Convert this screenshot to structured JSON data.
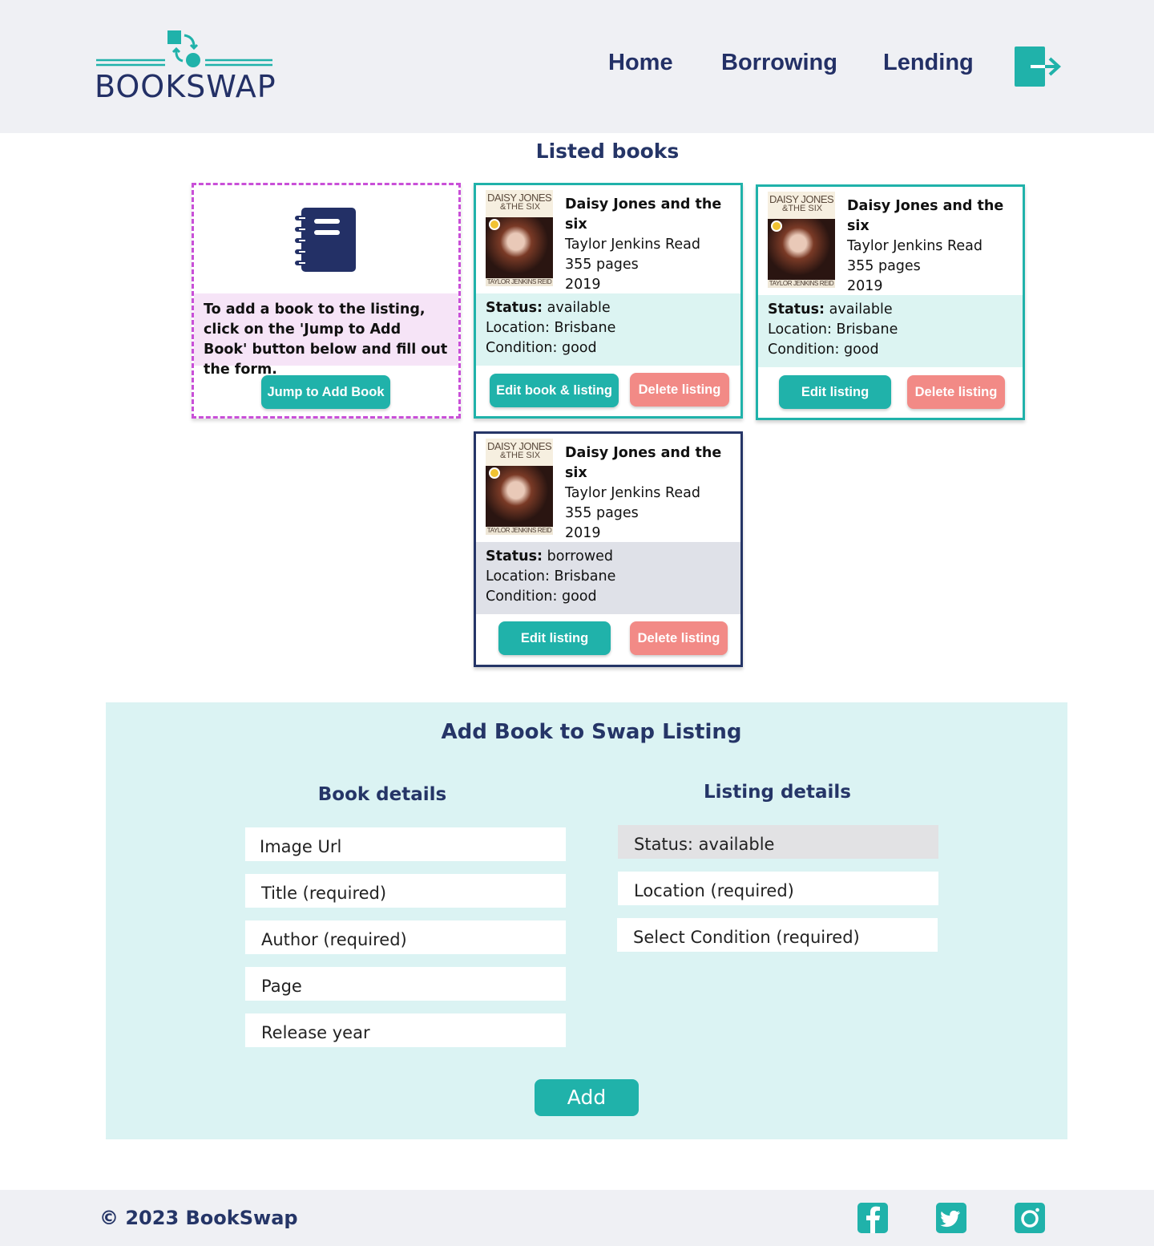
{
  "header": {
    "brand": "BOOKSWAP",
    "nav": [
      {
        "label": "Home"
      },
      {
        "label": "Borrowing"
      },
      {
        "label": "Lending"
      }
    ],
    "logout_icon": "logout-icon"
  },
  "listed": {
    "heading": "Listed books",
    "add_card": {
      "icon": "notebook-icon",
      "hint": "To add a book to the listing, click on the 'Jump to Add Book' button below and fill out the form.",
      "button": "Jump to Add Book"
    },
    "cover_text": {
      "line1": "DAISY JONES",
      "line2": "&THE SIX",
      "author": "TAYLOR JENKINS REID"
    },
    "books": [
      {
        "title": "Daisy Jones and the six",
        "author": "Taylor Jenkins Read",
        "pages": "355 pages",
        "year": "2019",
        "status_label": "Status:",
        "status": "available",
        "location": "Location: Brisbane",
        "condition": "Condition: good",
        "edit_button": "Edit book & listing",
        "delete_button": "Delete listing"
      },
      {
        "title": "Daisy Jones and the six",
        "author": "Taylor Jenkins Read",
        "pages": "355 pages",
        "year": "2019",
        "status_label": "Status:",
        "status": "available",
        "location": "Location: Brisbane",
        "condition": "Condition: good",
        "edit_button": "Edit listing",
        "delete_button": "Delete listing"
      },
      {
        "title": "Daisy Jones and the six",
        "author": "Taylor Jenkins Read",
        "pages": "355 pages",
        "year": "2019",
        "status_label": "Status:",
        "status": "borrowed",
        "location": "Location: Brisbane",
        "condition": "Condition: good",
        "edit_button": "Edit listing",
        "delete_button": "Delete listing"
      }
    ]
  },
  "form": {
    "heading": "Add Book to Swap Listing",
    "book_details_heading": "Book details",
    "listing_details_heading": "Listing details",
    "book_fields": [
      {
        "placeholder": "Image Url"
      },
      {
        "placeholder": "Title (required)"
      },
      {
        "placeholder": "Author (required)"
      },
      {
        "placeholder": "Page"
      },
      {
        "placeholder": "Release year"
      }
    ],
    "listing_fields": [
      {
        "value": "Status: available"
      },
      {
        "placeholder": "Location (required)"
      },
      {
        "placeholder": "Select Condition (required)"
      }
    ],
    "submit": "Add"
  },
  "footer": {
    "copyright": "© 2023 BookSwap",
    "social": [
      "facebook-icon",
      "twitter-icon",
      "instagram-icon"
    ]
  },
  "colors": {
    "teal": "#20b2aa",
    "navy": "#253567",
    "red": "#f28a86",
    "header_bg": "#eff0f4",
    "form_bg": "#dbf3f3"
  }
}
